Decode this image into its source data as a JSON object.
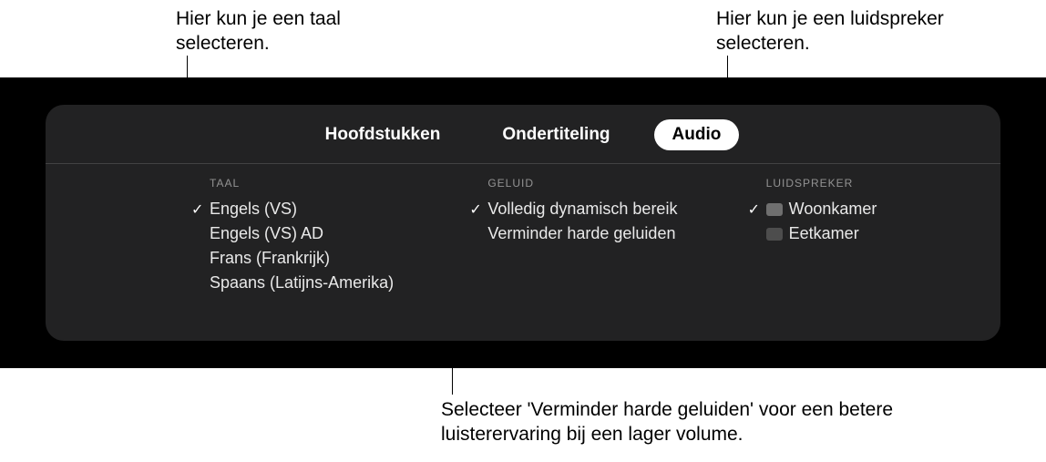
{
  "callouts": {
    "top_left": "Hier kun je een taal selecteren.",
    "top_right": "Hier kun je een luidspreker selecteren.",
    "bottom": "Selecteer 'Verminder harde geluiden' voor een betere luisterervaring bij een lager volume."
  },
  "tabs": {
    "hoofdstukken": "Hoofdstukken",
    "ondertiteling": "Ondertiteling",
    "audio": "Audio"
  },
  "columns": {
    "taal": {
      "header": "TAAL",
      "items": [
        {
          "label": "Engels (VS)",
          "selected": true
        },
        {
          "label": "Engels (VS) AD",
          "selected": false
        },
        {
          "label": "Frans (Frankrijk)",
          "selected": false
        },
        {
          "label": "Spaans (Latijns-Amerika)",
          "selected": false
        }
      ]
    },
    "geluid": {
      "header": "GELUID",
      "items": [
        {
          "label": "Volledig dynamisch bereik",
          "selected": true
        },
        {
          "label": "Verminder harde geluiden",
          "selected": false
        }
      ]
    },
    "luidspreker": {
      "header": "LUIDSPREKER",
      "items": [
        {
          "label": "Woonkamer",
          "selected": true
        },
        {
          "label": "Eetkamer",
          "selected": false
        }
      ]
    }
  }
}
